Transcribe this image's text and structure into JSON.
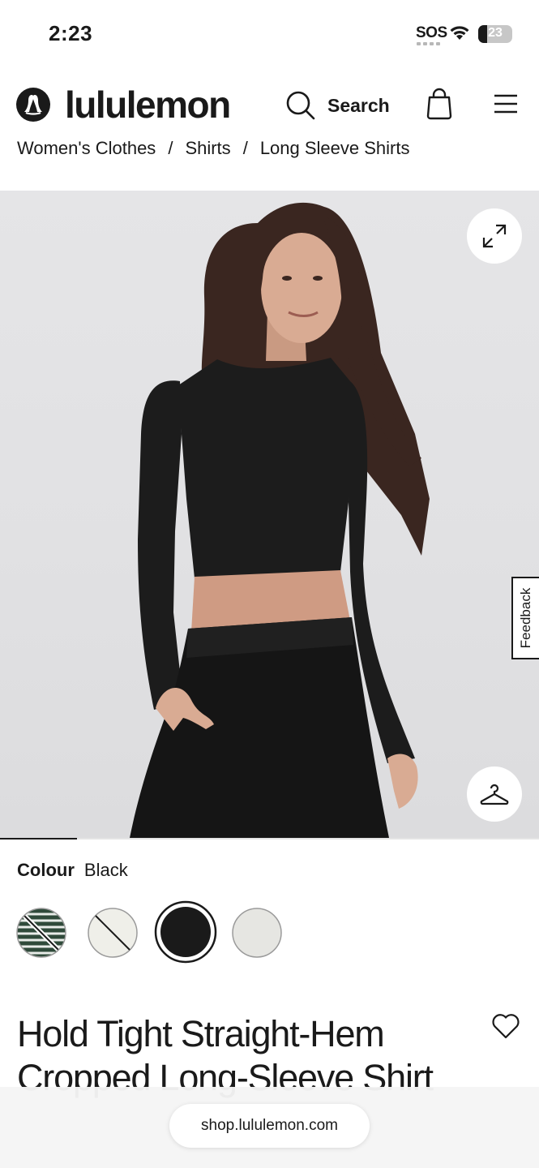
{
  "status_bar": {
    "time": "2:23",
    "carrier": "SOS",
    "battery": "23"
  },
  "header": {
    "brand": "lululemon",
    "logo_icon": "lululemon-logo-icon",
    "search_label": "Search",
    "search_icon": "search-icon",
    "bag_icon": "shopping-bag-icon",
    "menu_icon": "hamburger-menu-icon"
  },
  "breadcrumb": {
    "items": [
      "Women's Clothes",
      "Shirts",
      "Long Sleeve Shirts"
    ],
    "separator": "/"
  },
  "gallery": {
    "expand_icon": "expand-icon",
    "try_on_icon": "hanger-icon",
    "feedback_label": "Feedback",
    "progress_fraction": 0.143
  },
  "colour": {
    "label": "Colour",
    "selected": "Black",
    "swatches": [
      {
        "name": "green-stripe",
        "available": false
      },
      {
        "name": "white",
        "available": false
      },
      {
        "name": "black",
        "selected": true,
        "available": true
      },
      {
        "name": "light-grey",
        "available": true
      }
    ]
  },
  "product": {
    "title_line1": "Hold Tight Straight-Hem",
    "title_line2": "Cropped Long-Sleeve Shirt",
    "wishlist_icon": "heart-icon"
  },
  "browser": {
    "url": "shop.lululemon.com"
  },
  "colors": {
    "brand_text": "#1a1a1a",
    "accent": "#000000"
  }
}
